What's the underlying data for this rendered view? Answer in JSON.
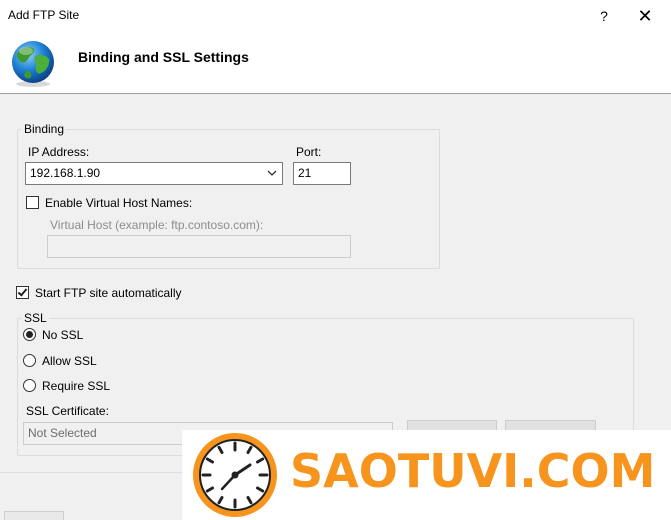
{
  "window": {
    "title": "Add FTP Site",
    "help_glyph": "?",
    "close_glyph": "✕"
  },
  "header": {
    "title": "Binding and SSL Settings",
    "icon": "globe-icon"
  },
  "binding": {
    "group_label": "Binding",
    "ip_label": "IP Address:",
    "ip_value": "192.168.1.90",
    "port_label": "Port:",
    "port_value": "21",
    "enable_virtual_label": "Enable Virtual Host Names:",
    "enable_virtual_checked": false,
    "virtual_host_label": "Virtual Host (example: ftp.contoso.com):",
    "virtual_host_value": ""
  },
  "start_auto": {
    "label": "Start FTP site automatically",
    "checked": true
  },
  "ssl": {
    "group_label": "SSL",
    "options": [
      {
        "label": "No SSL",
        "selected": true
      },
      {
        "label": "Allow SSL",
        "selected": false
      },
      {
        "label": "Require SSL",
        "selected": false
      }
    ],
    "cert_label": "SSL Certificate:",
    "cert_value": "Not Selected"
  },
  "watermark": {
    "text": "SAOTUVI.COM",
    "color": "#f7941d"
  },
  "colors": {
    "window_bg": "#f0f0f0",
    "accent_orange": "#f7941d"
  }
}
